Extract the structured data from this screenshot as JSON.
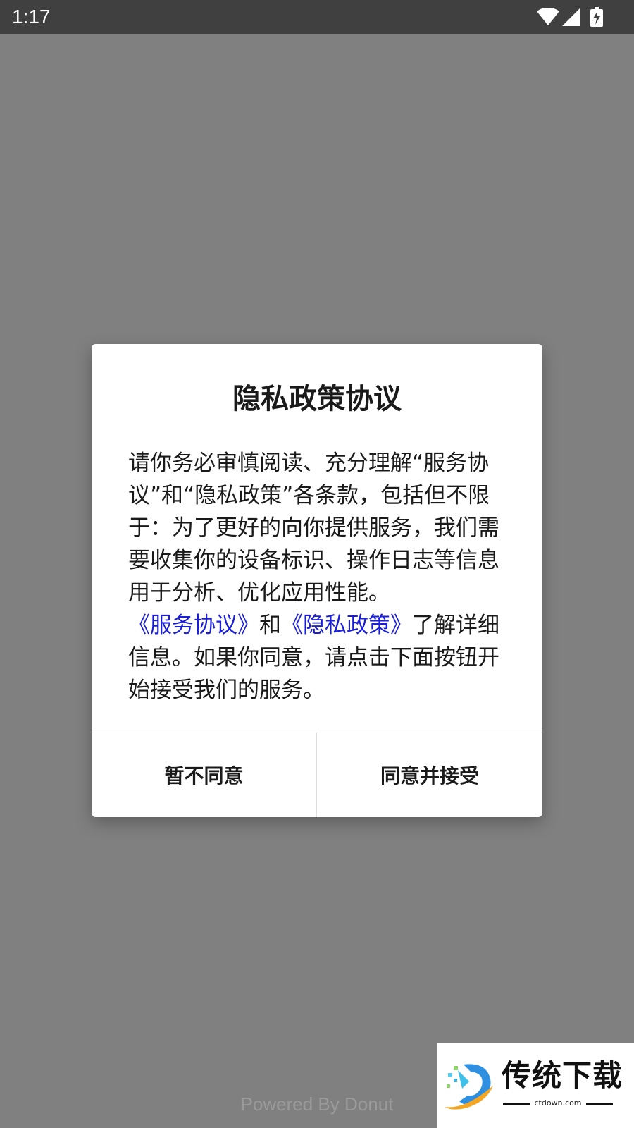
{
  "status_bar": {
    "time": "1:17",
    "icons": [
      "wifi-icon",
      "signal-icon",
      "battery-charging-icon"
    ]
  },
  "dialog": {
    "title": "隐私政策协议",
    "body": {
      "part1": "请你务必审慎阅读、充分理解“服务协议”和“隐私政策”各条款，包括但不限于：为了更好的向你提供服务，我们需要收集你的设备标识、操作日志等信息用于分析、优化应用性能。",
      "link_service": "《服务协议》",
      "part2": "和",
      "link_privacy": "《隐私政策》",
      "part3": "了解详细信息。如果你同意，请点击下面按钮开始接受我们的服务。"
    },
    "disagree_button": "暂不同意",
    "agree_button": "同意并接受"
  },
  "footer": {
    "powered_by": "Powered By Donut"
  },
  "watermark": {
    "brand": "传统下载",
    "domain": "ctdown.com"
  },
  "colors": {
    "background": "#808080",
    "status_bar": "#404040",
    "link": "#1a1ed9"
  }
}
